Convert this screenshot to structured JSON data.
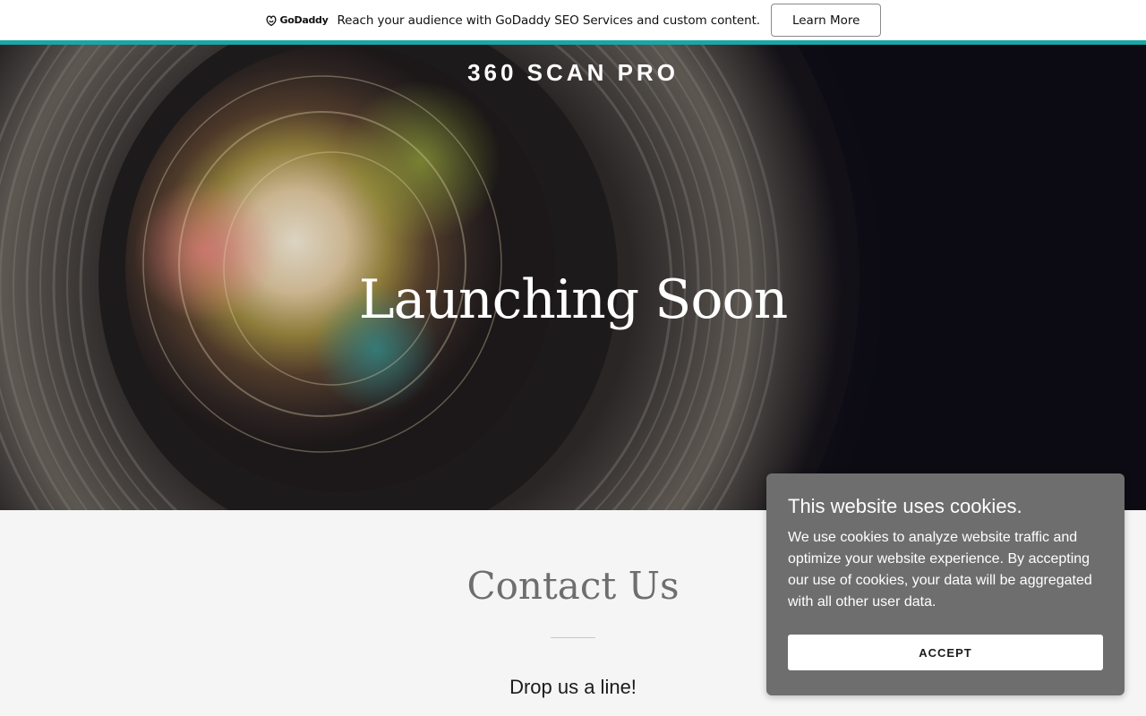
{
  "promo": {
    "brand": "GoDaddy",
    "message": "Reach your audience with GoDaddy SEO Services and custom content.",
    "cta_label": "Learn More",
    "accent_color": "#1ba5a5"
  },
  "hero": {
    "site_title": "360 SCAN PRO",
    "heading": "Launching Soon",
    "background_image": "camera-lens-closeup"
  },
  "contact": {
    "title": "Contact Us",
    "subtitle": "Drop us a line!"
  },
  "cookie_banner": {
    "title": "This website uses cookies.",
    "body": "We use cookies to analyze website traffic and optimize your website experience. By accepting our use of cookies, your data will be aggregated with all other user data.",
    "accept_label": "ACCEPT",
    "background_color": "#6e6e6e"
  }
}
